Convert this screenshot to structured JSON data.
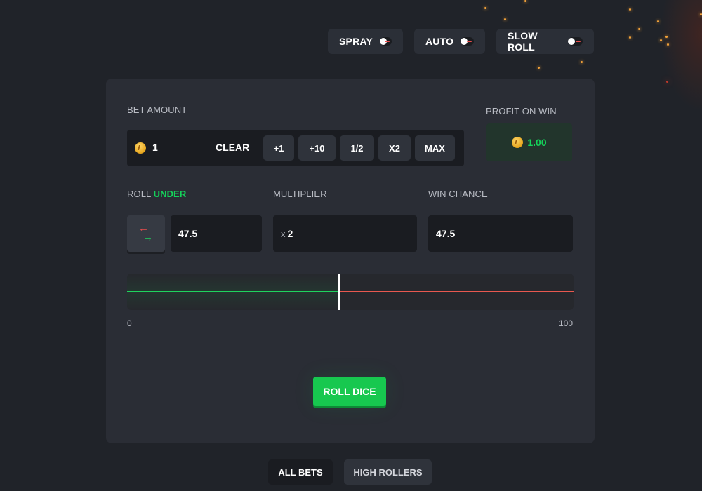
{
  "toggles": {
    "spray_label": "SPRAY",
    "auto_label": "AUTO",
    "slow_roll_label": "SLOW ROLL"
  },
  "bet": {
    "label": "BET AMOUNT",
    "value": "1",
    "clear_label": "CLEAR",
    "buttons": [
      "+1",
      "+10",
      "1/2",
      "X2",
      "MAX"
    ]
  },
  "profit": {
    "label": "PROFIT ON WIN",
    "value": "1.00"
  },
  "roll": {
    "label_prefix": "ROLL ",
    "label_accent": "UNDER",
    "value": "47.5"
  },
  "multiplier": {
    "label": "MULTIPLIER",
    "prefix": "x",
    "value": "2"
  },
  "win_chance": {
    "label": "WIN CHANCE",
    "value": "47.5"
  },
  "slider": {
    "min_label": "0",
    "max_label": "100",
    "value": 47.5,
    "min": 0,
    "max": 100
  },
  "roll_button_label": "ROLL DICE",
  "tabs": {
    "all_bets": "ALL BETS",
    "high_rollers": "HIGH ROLLERS"
  },
  "colors": {
    "accent_green": "#15d25a",
    "danger_red": "#e8584f",
    "background": "#202329",
    "panel": "#2a2d35"
  },
  "icons": {
    "coin": "coin-icon",
    "swap": "swap-arrows-icon"
  }
}
